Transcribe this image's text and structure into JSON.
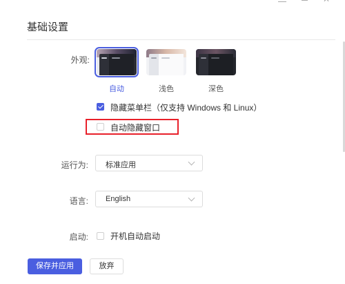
{
  "section": {
    "title": "基础设置"
  },
  "appearance": {
    "label": "外观:",
    "themes": [
      {
        "name": "自动",
        "selected": true
      },
      {
        "name": "浅色",
        "selected": false
      },
      {
        "name": "深色",
        "selected": false
      }
    ]
  },
  "hide_menu": {
    "checked": true,
    "label": "隐藏菜单栏（仅支持 Windows 和 Linux）"
  },
  "auto_hide": {
    "checked": false,
    "label": "自动隐藏窗口"
  },
  "run_as": {
    "label": "运行为:",
    "value": "标准应用"
  },
  "language": {
    "label": "语言:",
    "value": "English"
  },
  "startup": {
    "label": "启动:",
    "checked": false,
    "option_label": "开机自动启动"
  },
  "buttons": {
    "save": "保存并应用",
    "discard": "放弃"
  },
  "colors": {
    "accent": "#4a5ee0",
    "highlight": "#e8202a"
  }
}
